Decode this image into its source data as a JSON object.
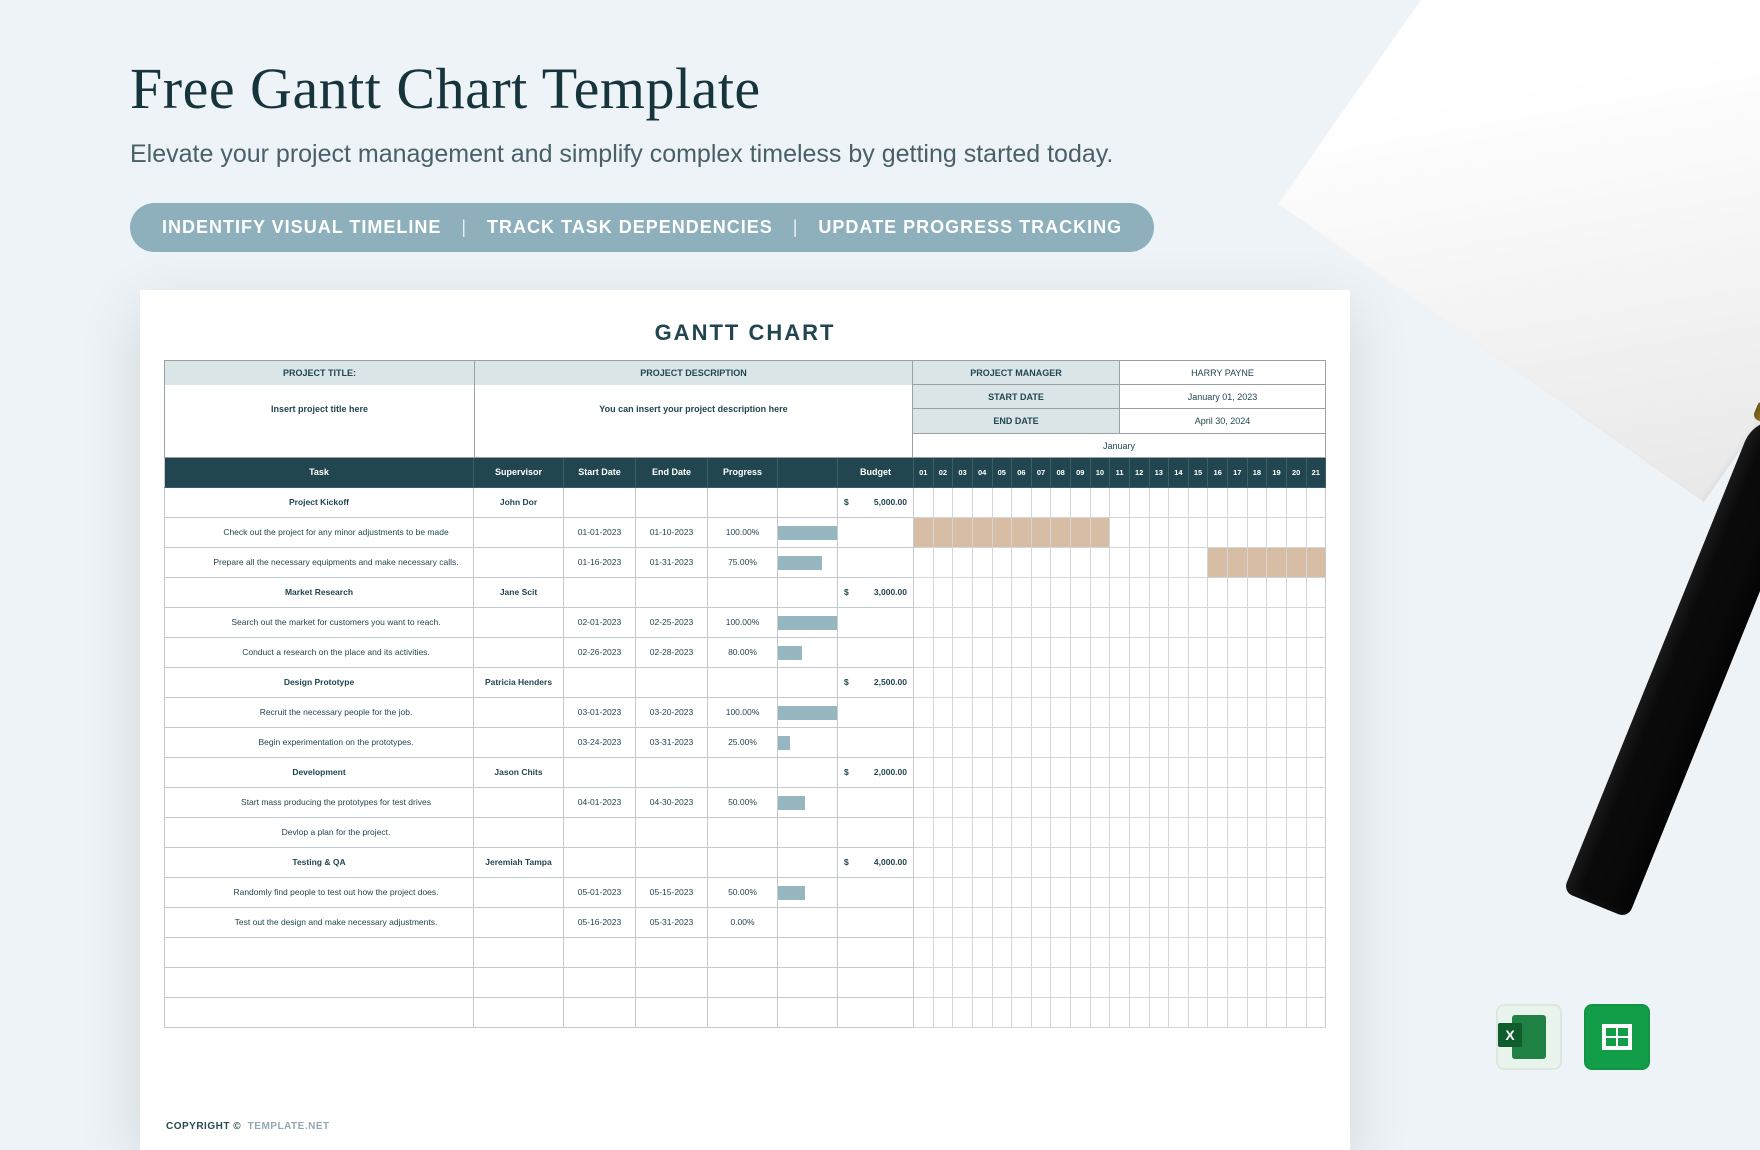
{
  "hero": {
    "title": "Free Gantt Chart Template",
    "subtitle": "Elevate your project management and simplify complex timeless by getting started today.",
    "features": [
      "INDENTIFY VISUAL TIMELINE",
      "TRACK TASK DEPENDENCIES",
      "UPDATE PROGRESS TRACKING"
    ]
  },
  "sheet": {
    "title": "GANTT CHART",
    "header": {
      "project_title_label": "PROJECT TITLE:",
      "project_title_value": "Insert project title here",
      "project_desc_label": "PROJECT DESCRIPTION",
      "project_desc_value": "You can insert your project description here",
      "manager_label": "PROJECT MANAGER",
      "manager_value": "HARRY PAYNE",
      "start_label": "START DATE",
      "start_value": "January 01, 2023",
      "end_label": "END DATE",
      "end_value": "April 30, 2024",
      "month": "January"
    },
    "columns": {
      "task": "Task",
      "supervisor": "Supervisor",
      "start": "Start Date",
      "end": "End Date",
      "progress": "Progress",
      "budget": "Budget"
    },
    "days": [
      "01",
      "02",
      "03",
      "04",
      "05",
      "06",
      "07",
      "08",
      "09",
      "10",
      "11",
      "12",
      "13",
      "14",
      "15",
      "16",
      "17",
      "18",
      "19",
      "20",
      "21"
    ],
    "rows": [
      {
        "type": "section",
        "task": "Project Kickoff",
        "supervisor": "John Dor",
        "budget": "5,000.00"
      },
      {
        "type": "sub",
        "task": "Check out the project for any minor adjustments to be made",
        "start": "01-01-2023",
        "end": "01-10-2023",
        "progress": "100.00%",
        "bar": 100,
        "gantt": [
          1,
          10
        ]
      },
      {
        "type": "sub",
        "task": "Prepare all the necessary equipments and make necessary calls.",
        "start": "01-16-2023",
        "end": "01-31-2023",
        "progress": "75.00%",
        "bar": 75,
        "gantt": [
          16,
          21
        ]
      },
      {
        "type": "section",
        "task": "Market Research",
        "supervisor": "Jane Scit",
        "budget": "3,000.00"
      },
      {
        "type": "sub",
        "task": "Search out the market for customers you want to reach.",
        "start": "02-01-2023",
        "end": "02-25-2023",
        "progress": "100.00%",
        "bar": 100
      },
      {
        "type": "sub",
        "task": "Conduct a research on the place and its activities.",
        "start": "02-26-2023",
        "end": "02-28-2023",
        "progress": "80.00%",
        "bar": 40
      },
      {
        "type": "section",
        "task": "Design Prototype",
        "supervisor": "Patricia Henders",
        "budget": "2,500.00"
      },
      {
        "type": "sub",
        "task": "Recruit the necessary people for the job.",
        "start": "03-01-2023",
        "end": "03-20-2023",
        "progress": "100.00%",
        "bar": 100
      },
      {
        "type": "sub",
        "task": "Begin experimentation on the prototypes.",
        "start": "03-24-2023",
        "end": "03-31-2023",
        "progress": "25.00%",
        "bar": 20
      },
      {
        "type": "section",
        "task": "Development",
        "supervisor": "Jason Chits",
        "budget": "2,000.00"
      },
      {
        "type": "sub",
        "task": "Start mass producing the prototypes for test drives",
        "start": "04-01-2023",
        "end": "04-30-2023",
        "progress": "50.00%",
        "bar": 45
      },
      {
        "type": "sub",
        "task": "Devlop a plan for the project.",
        "start": "",
        "end": "",
        "progress": "",
        "bar": 0
      },
      {
        "type": "section",
        "task": "Testing & QA",
        "supervisor": "Jeremiah Tampa",
        "budget": "4,000.00"
      },
      {
        "type": "sub",
        "task": "Randomly find people to test out how the project does.",
        "start": "05-01-2023",
        "end": "05-15-2023",
        "progress": "50.00%",
        "bar": 45
      },
      {
        "type": "sub",
        "task": "Test out the design and make necessary adjustments.",
        "start": "05-16-2023",
        "end": "05-31-2023",
        "progress": "0.00%",
        "bar": 0
      },
      {
        "type": "blank"
      },
      {
        "type": "blank"
      },
      {
        "type": "blank"
      }
    ],
    "copyright_prefix": "COPYRIGHT  ©",
    "copyright_brand": "TEMPLATE.NET"
  },
  "apps": {
    "excel": "Microsoft Excel",
    "sheets": "Google Sheets"
  }
}
